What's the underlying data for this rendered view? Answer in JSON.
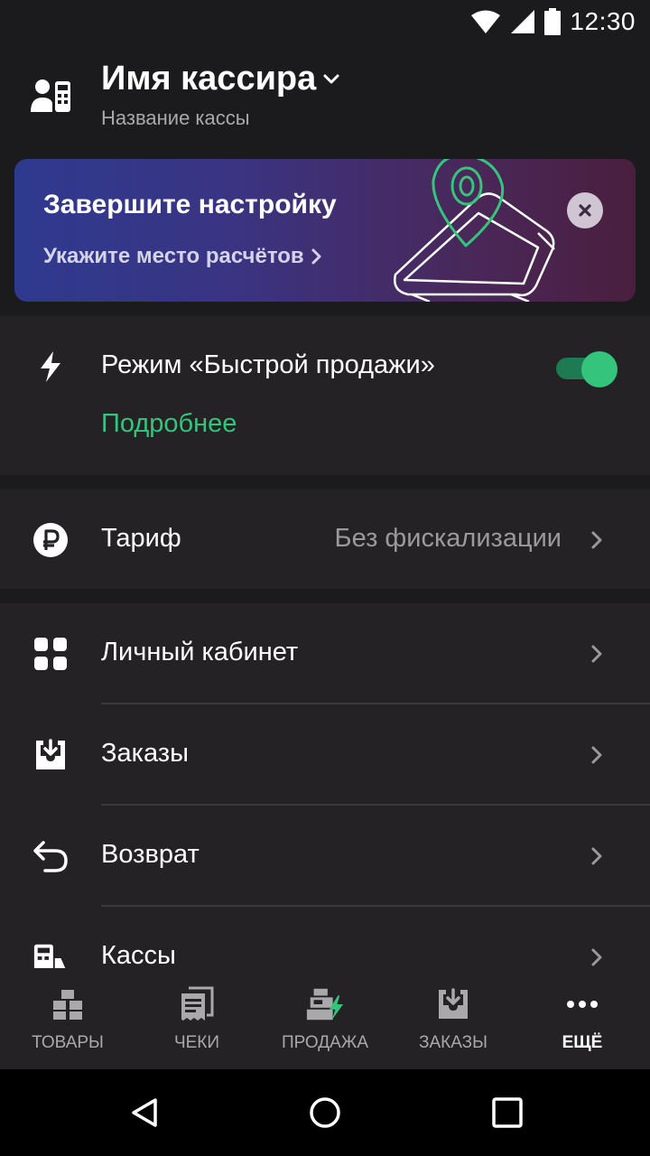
{
  "status_bar": {
    "time": "12:30",
    "icons": [
      "wifi-icon",
      "signal-icon",
      "battery-icon"
    ]
  },
  "header": {
    "cashier_name": "Имя кассира",
    "register_name": "Название кассы"
  },
  "banner": {
    "title": "Завершите настройку",
    "link": "Укажите место расчётов"
  },
  "quick_sale": {
    "label": "Режим «Быстрой продажи»",
    "more_link": "Подробнее",
    "enabled": true
  },
  "tariff": {
    "label": "Тариф",
    "value": "Без фискализации"
  },
  "menu": {
    "items": [
      {
        "label": "Личный кабинет",
        "icon": "dashboard-icon"
      },
      {
        "label": "Заказы",
        "icon": "inbox-download-icon"
      },
      {
        "label": "Возврат",
        "icon": "return-arrow-icon"
      },
      {
        "label": "Кассы",
        "icon": "cash-register-icon"
      }
    ]
  },
  "tabbar": {
    "tabs": [
      {
        "label": "ТОВАРЫ",
        "icon": "boxes-icon"
      },
      {
        "label": "ЧЕКИ",
        "icon": "receipts-icon"
      },
      {
        "label": "ПРОДАЖА",
        "icon": "sale-register-icon"
      },
      {
        "label": "ЗАКАЗЫ",
        "icon": "orders-inbox-icon"
      },
      {
        "label": "ЕЩЁ",
        "icon": "more-dots-icon",
        "active": true
      }
    ]
  },
  "colors": {
    "accent": "#35c47c",
    "background": "#1b1a1c",
    "card": "#242225",
    "muted_text": "#9a999c"
  }
}
